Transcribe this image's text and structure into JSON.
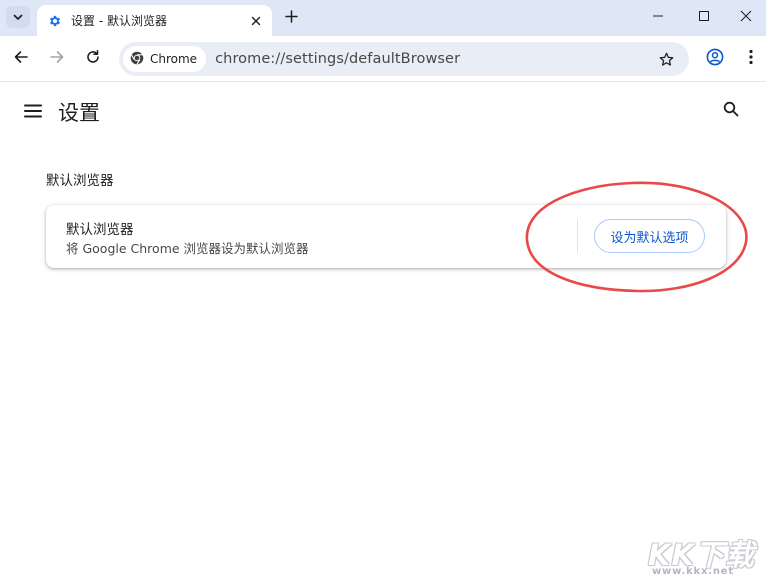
{
  "tab": {
    "title": "设置 - 默认浏览器"
  },
  "toolbar": {
    "chip_label": "Chrome",
    "url": "chrome://settings/defaultBrowser"
  },
  "page": {
    "title": "设置",
    "section_title": "默认浏览器",
    "row_label": "默认浏览器",
    "row_description": "将 Google Chrome 浏览器设为默认浏览器",
    "make_default_button": "设为默认选项"
  },
  "icons": {
    "tab_search": "chevron-down-icon",
    "tab_favicon": "gear-icon",
    "tab_close": "close-icon",
    "new_tab": "plus-icon",
    "back": "arrow-left-icon",
    "forward": "arrow-right-icon",
    "reload": "reload-icon",
    "chrome": "chrome-icon",
    "bookmark": "star-icon",
    "profile": "profile-icon",
    "menu": "kebab-icon",
    "hamburger": "hamburger-icon",
    "search": "search-icon"
  },
  "colors": {
    "accent": "#0b57d0",
    "tabstrip": "#dfe7f6",
    "omnibox": "#e9eef6",
    "annotation": "#e84a4a"
  },
  "watermark": {
    "logo": "KK下载",
    "url": "www.kkx.net"
  }
}
